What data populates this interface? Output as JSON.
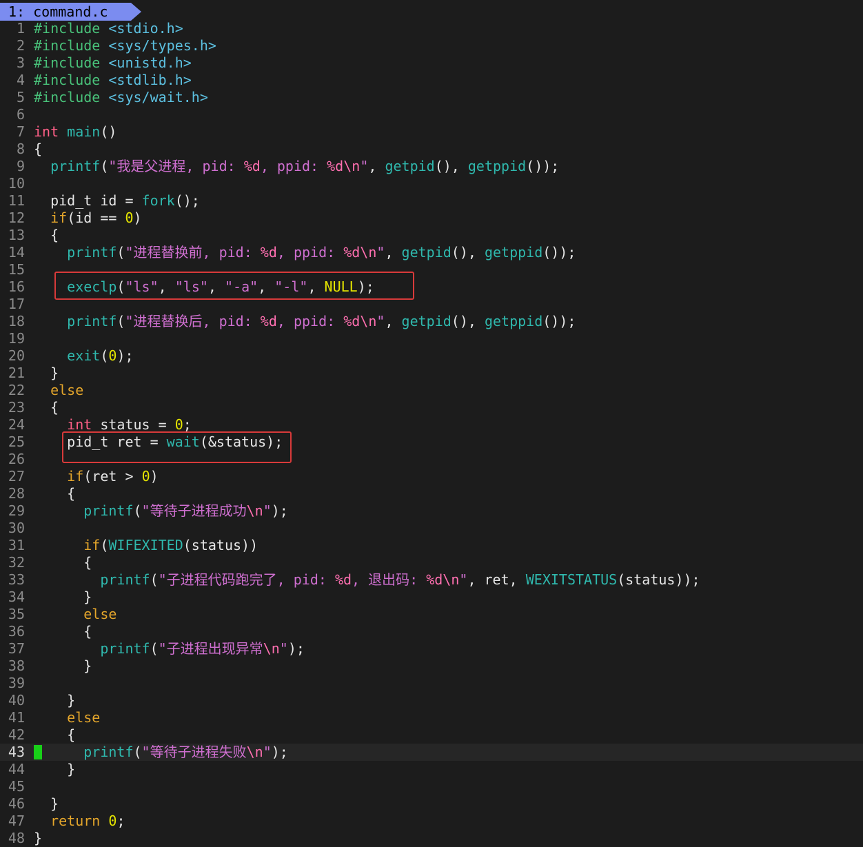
{
  "tab": {
    "label": "1: command.c"
  },
  "cursor_line": 43,
  "lines": [
    {
      "n": "1",
      "tokens": [
        [
          "pp",
          "#include "
        ],
        [
          "inc",
          "<stdio.h>"
        ]
      ]
    },
    {
      "n": "2",
      "tokens": [
        [
          "pp",
          "#include "
        ],
        [
          "inc",
          "<sys/types.h>"
        ]
      ]
    },
    {
      "n": "3",
      "tokens": [
        [
          "pp",
          "#include "
        ],
        [
          "inc",
          "<unistd.h>"
        ]
      ]
    },
    {
      "n": "4",
      "tokens": [
        [
          "pp",
          "#include "
        ],
        [
          "inc",
          "<stdlib.h>"
        ]
      ]
    },
    {
      "n": "5",
      "tokens": [
        [
          "pp",
          "#include "
        ],
        [
          "inc",
          "<sys/wait.h>"
        ]
      ]
    },
    {
      "n": "6",
      "tokens": []
    },
    {
      "n": "7",
      "tokens": [
        [
          "ty",
          "int "
        ],
        [
          "fn",
          "main"
        ],
        [
          "pl",
          "()"
        ]
      ]
    },
    {
      "n": "8",
      "tokens": [
        [
          "pl",
          "{"
        ]
      ]
    },
    {
      "n": "9",
      "tokens": [
        [
          "pl",
          "  "
        ],
        [
          "fn",
          "printf"
        ],
        [
          "pl",
          "("
        ],
        [
          "st",
          "\"我是父进程, pid: "
        ],
        [
          "fmt",
          "%d"
        ],
        [
          "st",
          ", ppid: "
        ],
        [
          "fmt",
          "%d\\n"
        ],
        [
          "st",
          "\""
        ],
        [
          "pl",
          ", "
        ],
        [
          "fn",
          "getpid"
        ],
        [
          "pl",
          "(), "
        ],
        [
          "fn",
          "getppid"
        ],
        [
          "pl",
          "());"
        ]
      ]
    },
    {
      "n": "10",
      "tokens": []
    },
    {
      "n": "11",
      "tokens": [
        [
          "pl",
          "  pid_t id = "
        ],
        [
          "fn",
          "fork"
        ],
        [
          "pl",
          "();"
        ]
      ]
    },
    {
      "n": "12",
      "tokens": [
        [
          "pl",
          "  "
        ],
        [
          "kw",
          "if"
        ],
        [
          "pl",
          "(id == "
        ],
        [
          "num",
          "0"
        ],
        [
          "pl",
          ")"
        ]
      ]
    },
    {
      "n": "13",
      "tokens": [
        [
          "pl",
          "  {"
        ]
      ]
    },
    {
      "n": "14",
      "tokens": [
        [
          "pl",
          "    "
        ],
        [
          "fn",
          "printf"
        ],
        [
          "pl",
          "("
        ],
        [
          "st",
          "\"进程替换前, pid: "
        ],
        [
          "fmt",
          "%d"
        ],
        [
          "st",
          ", ppid: "
        ],
        [
          "fmt",
          "%d\\n"
        ],
        [
          "st",
          "\""
        ],
        [
          "pl",
          ", "
        ],
        [
          "fn",
          "getpid"
        ],
        [
          "pl",
          "(), "
        ],
        [
          "fn",
          "getppid"
        ],
        [
          "pl",
          "());"
        ]
      ]
    },
    {
      "n": "15",
      "tokens": []
    },
    {
      "n": "16",
      "tokens": [
        [
          "pl",
          "    "
        ],
        [
          "fn",
          "execlp"
        ],
        [
          "pl",
          "("
        ],
        [
          "st",
          "\"ls\""
        ],
        [
          "pl",
          ", "
        ],
        [
          "st",
          "\"ls\""
        ],
        [
          "pl",
          ", "
        ],
        [
          "st",
          "\"-a\""
        ],
        [
          "pl",
          ", "
        ],
        [
          "st",
          "\"-l\""
        ],
        [
          "pl",
          ", "
        ],
        [
          "mac",
          "NULL"
        ],
        [
          "pl",
          ");"
        ]
      ]
    },
    {
      "n": "17",
      "tokens": []
    },
    {
      "n": "18",
      "tokens": [
        [
          "pl",
          "    "
        ],
        [
          "fn",
          "printf"
        ],
        [
          "pl",
          "("
        ],
        [
          "st",
          "\"进程替换后, pid: "
        ],
        [
          "fmt",
          "%d"
        ],
        [
          "st",
          ", ppid: "
        ],
        [
          "fmt",
          "%d\\n"
        ],
        [
          "st",
          "\""
        ],
        [
          "pl",
          ", "
        ],
        [
          "fn",
          "getpid"
        ],
        [
          "pl",
          "(), "
        ],
        [
          "fn",
          "getppid"
        ],
        [
          "pl",
          "());"
        ]
      ]
    },
    {
      "n": "19",
      "tokens": []
    },
    {
      "n": "20",
      "tokens": [
        [
          "pl",
          "    "
        ],
        [
          "fn",
          "exit"
        ],
        [
          "pl",
          "("
        ],
        [
          "num",
          "0"
        ],
        [
          "pl",
          ");"
        ]
      ]
    },
    {
      "n": "21",
      "tokens": [
        [
          "pl",
          "  }"
        ]
      ]
    },
    {
      "n": "22",
      "tokens": [
        [
          "pl",
          "  "
        ],
        [
          "kw",
          "else"
        ]
      ]
    },
    {
      "n": "23",
      "tokens": [
        [
          "pl",
          "  {"
        ]
      ]
    },
    {
      "n": "24",
      "tokens": [
        [
          "pl",
          "    "
        ],
        [
          "ty",
          "int"
        ],
        [
          "pl",
          " status = "
        ],
        [
          "num",
          "0"
        ],
        [
          "pl",
          ";"
        ]
      ]
    },
    {
      "n": "25",
      "tokens": [
        [
          "pl",
          "    pid_t ret = "
        ],
        [
          "fn",
          "wait"
        ],
        [
          "pl",
          "(&status);"
        ]
      ]
    },
    {
      "n": "26",
      "tokens": []
    },
    {
      "n": "27",
      "tokens": [
        [
          "pl",
          "    "
        ],
        [
          "kw",
          "if"
        ],
        [
          "pl",
          "(ret > "
        ],
        [
          "num",
          "0"
        ],
        [
          "pl",
          ")"
        ]
      ]
    },
    {
      "n": "28",
      "tokens": [
        [
          "pl",
          "    {"
        ]
      ]
    },
    {
      "n": "29",
      "tokens": [
        [
          "pl",
          "      "
        ],
        [
          "fn",
          "printf"
        ],
        [
          "pl",
          "("
        ],
        [
          "st",
          "\"等待子进程成功"
        ],
        [
          "fmt",
          "\\n"
        ],
        [
          "st",
          "\""
        ],
        [
          "pl",
          ");"
        ]
      ]
    },
    {
      "n": "30",
      "tokens": []
    },
    {
      "n": "31",
      "tokens": [
        [
          "pl",
          "      "
        ],
        [
          "kw",
          "if"
        ],
        [
          "pl",
          "("
        ],
        [
          "fn",
          "WIFEXITED"
        ],
        [
          "pl",
          "(status))"
        ]
      ]
    },
    {
      "n": "32",
      "tokens": [
        [
          "pl",
          "      {"
        ]
      ]
    },
    {
      "n": "33",
      "tokens": [
        [
          "pl",
          "        "
        ],
        [
          "fn",
          "printf"
        ],
        [
          "pl",
          "("
        ],
        [
          "st",
          "\"子进程代码跑完了, pid: "
        ],
        [
          "fmt",
          "%d"
        ],
        [
          "st",
          ", 退出码: "
        ],
        [
          "fmt",
          "%d\\n"
        ],
        [
          "st",
          "\""
        ],
        [
          "pl",
          ", ret, "
        ],
        [
          "fn",
          "WEXITSTATUS"
        ],
        [
          "pl",
          "(status));"
        ]
      ]
    },
    {
      "n": "34",
      "tokens": [
        [
          "pl",
          "      }"
        ]
      ]
    },
    {
      "n": "35",
      "tokens": [
        [
          "pl",
          "      "
        ],
        [
          "kw",
          "else"
        ]
      ]
    },
    {
      "n": "36",
      "tokens": [
        [
          "pl",
          "      {"
        ]
      ]
    },
    {
      "n": "37",
      "tokens": [
        [
          "pl",
          "        "
        ],
        [
          "fn",
          "printf"
        ],
        [
          "pl",
          "("
        ],
        [
          "st",
          "\"子进程出现异常"
        ],
        [
          "fmt",
          "\\n"
        ],
        [
          "st",
          "\""
        ],
        [
          "pl",
          ");"
        ]
      ]
    },
    {
      "n": "38",
      "tokens": [
        [
          "pl",
          "      }"
        ]
      ]
    },
    {
      "n": "39",
      "tokens": []
    },
    {
      "n": "40",
      "tokens": [
        [
          "pl",
          "    }"
        ]
      ]
    },
    {
      "n": "41",
      "tokens": [
        [
          "pl",
          "    "
        ],
        [
          "kw",
          "else"
        ]
      ]
    },
    {
      "n": "42",
      "tokens": [
        [
          "pl",
          "    {"
        ]
      ]
    },
    {
      "n": "43",
      "tokens": [
        [
          "pl",
          "      "
        ],
        [
          "fn",
          "printf"
        ],
        [
          "pl",
          "("
        ],
        [
          "st",
          "\"等待子进程失败"
        ],
        [
          "fmt",
          "\\n"
        ],
        [
          "st",
          "\""
        ],
        [
          "pl",
          ");"
        ]
      ]
    },
    {
      "n": "44",
      "tokens": [
        [
          "pl",
          "    }"
        ]
      ]
    },
    {
      "n": "45",
      "tokens": []
    },
    {
      "n": "46",
      "tokens": [
        [
          "pl",
          "  }"
        ]
      ]
    },
    {
      "n": "47",
      "tokens": [
        [
          "pl",
          "  "
        ],
        [
          "kw",
          "return "
        ],
        [
          "num",
          "0"
        ],
        [
          "pl",
          ";"
        ]
      ]
    },
    {
      "n": "48",
      "tokens": [
        [
          "pl",
          "}"
        ]
      ]
    }
  ],
  "colors": {
    "background": "#1c1c1c",
    "tab_bg": "#7b8cf0",
    "cursor": "#18d018",
    "highlight_box": "#d83a3a"
  }
}
